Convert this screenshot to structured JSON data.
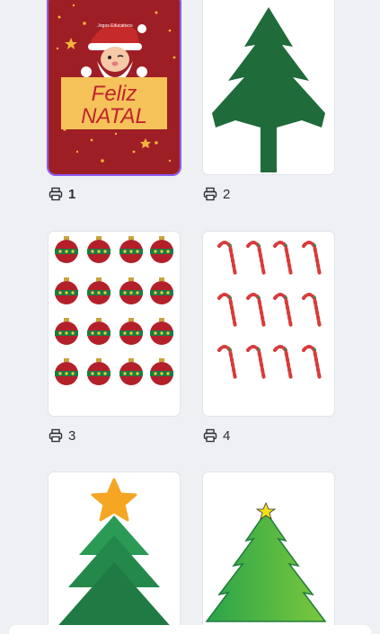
{
  "pages": [
    {
      "number": "1",
      "selected": true,
      "art_text": {
        "line1": "Feliz",
        "line2": "NATAL",
        "brand": "Jogos Educativos"
      }
    },
    {
      "number": "2",
      "selected": false
    },
    {
      "number": "3",
      "selected": false
    },
    {
      "number": "4",
      "selected": false
    },
    {
      "number": "",
      "selected": false
    },
    {
      "number": "",
      "selected": false
    }
  ],
  "colors": {
    "accent": "#8b5cf6",
    "tree_green": "#1f6b3a",
    "card_red": "#9e1e26"
  },
  "icons": {
    "print": "printer-icon"
  }
}
